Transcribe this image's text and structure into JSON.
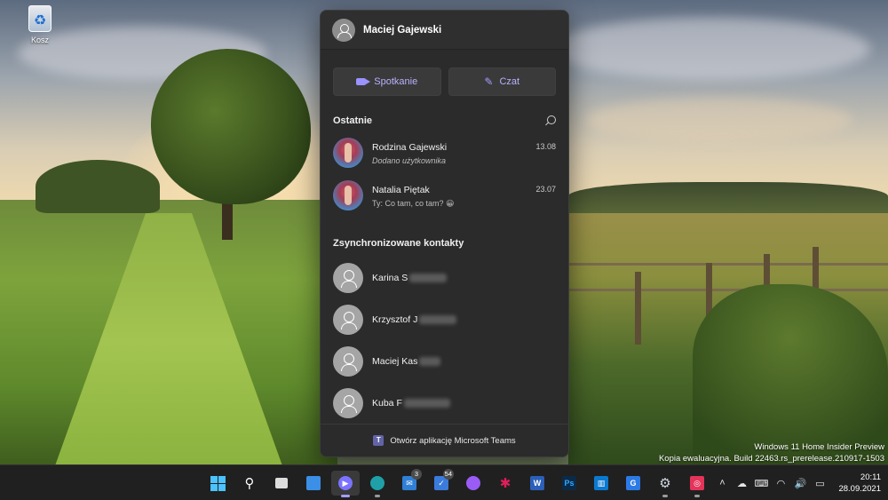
{
  "desktop": {
    "recycle_bin_label": "Kosz",
    "watermark_line1": "Windows 11 Home Insider Preview",
    "watermark_line2": "Kopia ewaluacyjna. Build 22463.rs_prerelease.210917-1503"
  },
  "flyout": {
    "user_name": "Maciej Gajewski",
    "meet_label": "Spotkanie",
    "chat_label": "Czat",
    "recent_heading": "Ostatnie",
    "recent": [
      {
        "name": "Rodzina Gajewski",
        "preview": "Dodano użytkownika",
        "date": "13.08"
      },
      {
        "name": "Natalia Piętak",
        "preview": "Ty: Co tam, co tam? 😀",
        "date": "23.07"
      }
    ],
    "synced_heading": "Zsynchronizowane kontakty",
    "contacts": [
      {
        "name": "Karina S"
      },
      {
        "name": "Krzysztof J"
      },
      {
        "name": "Maciej Kas"
      },
      {
        "name": "Kuba F"
      }
    ],
    "footer_label": "Otwórz aplikację Microsoft Teams"
  },
  "taskbar": {
    "mail_badge": "3",
    "todo_badge": "54",
    "clock_time": "20:11",
    "clock_date": "28.09.2021"
  },
  "colors": {
    "teams_accent": "#a49dff",
    "taskbar_bg": "#202020",
    "flyout_bg": "#2b2b2b"
  }
}
